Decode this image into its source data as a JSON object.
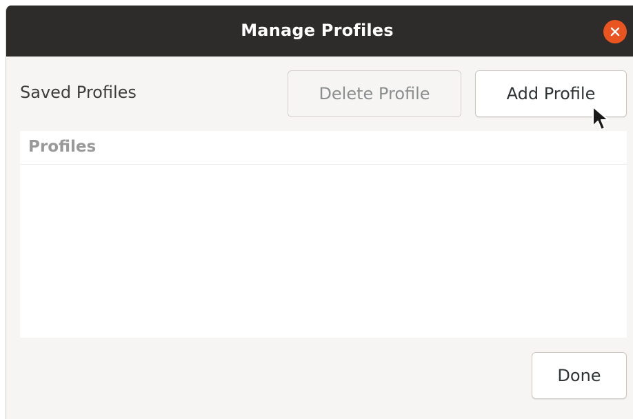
{
  "window": {
    "title": "Manage Profiles",
    "close_icon": "close-icon",
    "accent_color": "#e95420",
    "titlebar_color": "#2d2c2a"
  },
  "toolbar": {
    "saved_label": "Saved Profiles",
    "delete_label": "Delete Profile",
    "delete_enabled": false,
    "add_label": "Add Profile"
  },
  "profiles_list": {
    "column_header": "Profiles",
    "items": []
  },
  "footer": {
    "done_label": "Done"
  },
  "cursor_icon": "pointer-arrow-icon"
}
